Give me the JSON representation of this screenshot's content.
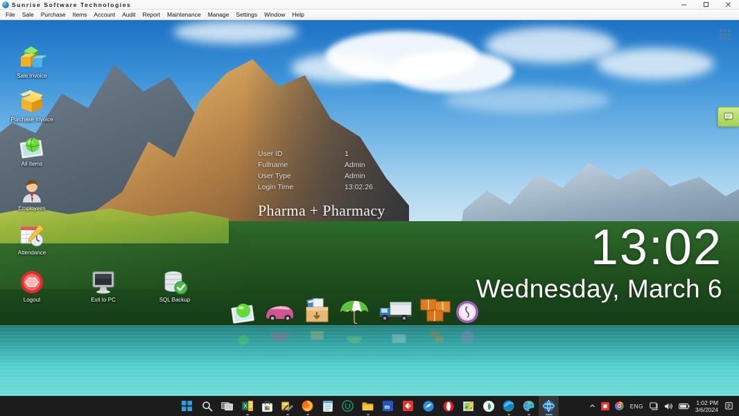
{
  "window": {
    "title": "Sunrise Software Technologies",
    "app_icon": "globe-icon",
    "controls": {
      "minimize": "minimize-icon",
      "maximize": "maximize-icon",
      "close": "close-icon"
    }
  },
  "menubar": {
    "items": [
      {
        "label": "File"
      },
      {
        "label": "Sale"
      },
      {
        "label": "Purchase"
      },
      {
        "label": "Items"
      },
      {
        "label": "Account"
      },
      {
        "label": "Audit"
      },
      {
        "label": "Report"
      },
      {
        "label": "Maintenance"
      },
      {
        "label": "Manage"
      },
      {
        "label": "Settings"
      },
      {
        "label": "Window"
      },
      {
        "label": "Help"
      }
    ]
  },
  "desktop_icons": [
    {
      "label": "Sale Invoice",
      "icon": "cubes-icon"
    },
    {
      "label": "Purchase Invoice",
      "icon": "open-box-icon"
    },
    {
      "label": "All Items",
      "icon": "photo-globe-icon"
    },
    {
      "label": "Employees",
      "icon": "person-icon"
    },
    {
      "label": "Attendance",
      "icon": "calendar-clock-icon"
    },
    {
      "label": "Logout",
      "icon": "power-stop-icon"
    },
    {
      "label": "Exit to PC",
      "icon": "monitor-icon"
    },
    {
      "label": "SQL Backup",
      "icon": "database-check-icon"
    }
  ],
  "session_info": {
    "rows": [
      {
        "key": "User ID",
        "value": "1"
      },
      {
        "key": "Fullname",
        "value": "Admin"
      },
      {
        "key": "User Type",
        "value": "Admin"
      },
      {
        "key": "Login Time",
        "value": "13:02:26"
      }
    ]
  },
  "branding": {
    "title": "Pharma + Pharmacy"
  },
  "clock_widget": {
    "time": "13:02",
    "date": "Wednesday, March 6"
  },
  "side_widget": {
    "icon": "chat-bubble-icon"
  },
  "app_grid": {
    "icon": "grid-dots-icon"
  },
  "dock": {
    "items": [
      {
        "icon": "photo-globe-icon"
      },
      {
        "icon": "car-icon"
      },
      {
        "icon": "archive-box-icon"
      },
      {
        "icon": "umbrella-icon"
      },
      {
        "icon": "delivery-truck-icon"
      },
      {
        "icon": "packages-icon"
      },
      {
        "icon": "clock-icon"
      }
    ]
  },
  "taskbar": {
    "pinned": [
      {
        "name": "start-button",
        "icon": "windows-logo-icon"
      },
      {
        "name": "search-button",
        "icon": "search-icon"
      },
      {
        "name": "task-view-button",
        "icon": "task-view-icon"
      },
      {
        "name": "excel-app",
        "icon": "excel-icon"
      },
      {
        "name": "microsoft-store-app",
        "icon": "store-icon"
      },
      {
        "name": "tools-app",
        "icon": "tools-icon"
      },
      {
        "name": "firefox-app",
        "icon": "firefox-icon"
      },
      {
        "name": "notepad-app",
        "icon": "notepad-icon"
      },
      {
        "name": "utorrent-app",
        "icon": "u-circle-icon"
      },
      {
        "name": "file-explorer-app",
        "icon": "folder-icon"
      },
      {
        "name": "media-app",
        "icon": "m-square-icon"
      },
      {
        "name": "recorder-app",
        "icon": "red-diamond-icon"
      },
      {
        "name": "browser-app",
        "icon": "blue-circle-icon"
      },
      {
        "name": "opera-app",
        "icon": "opera-icon"
      },
      {
        "name": "photo-editor-app",
        "icon": "image-edit-icon"
      },
      {
        "name": "antivirus-app",
        "icon": "green-shield-icon"
      },
      {
        "name": "edge-app",
        "icon": "edge-icon"
      },
      {
        "name": "paint-app",
        "icon": "paint-icon"
      },
      {
        "name": "sunrise-app",
        "icon": "globe-icon",
        "active": true
      }
    ],
    "tray": {
      "overflow": "chevron-up-icon",
      "icons": [
        {
          "name": "recording-indicator",
          "icon": "red-square-icon"
        },
        {
          "name": "chrome-tray",
          "icon": "chrome-icon"
        }
      ],
      "language": "ENG",
      "network": "network-icon",
      "volume": "volume-icon",
      "battery": "battery-icon",
      "time": "1:02 PM",
      "date": "3/6/2024",
      "notifications": "notification-icon"
    }
  }
}
